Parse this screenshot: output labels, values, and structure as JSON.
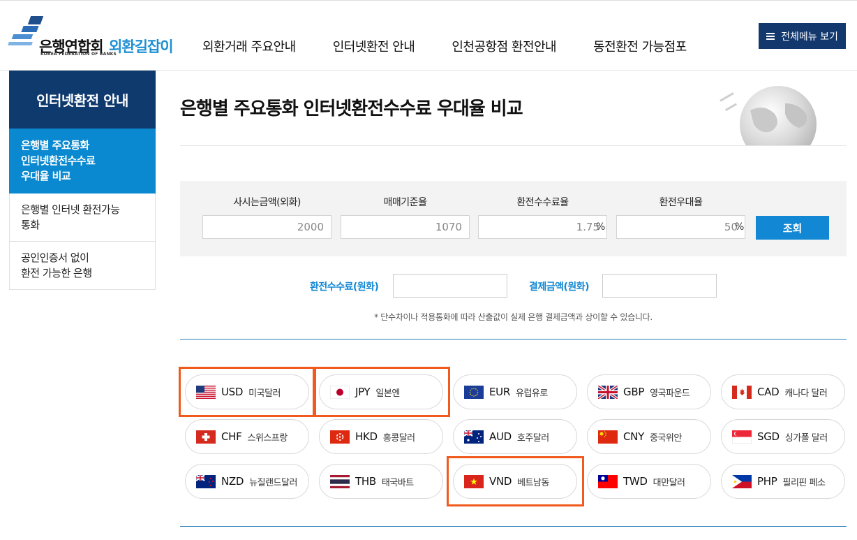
{
  "header": {
    "logo_kor": "은행연합회",
    "logo_sub": "KOREA FEDERATION OF BANKS",
    "logo_service": "외환길잡이",
    "nav": [
      "외환거래 주요안내",
      "인터넷환전 안내",
      "인천공항점 환전안내",
      "동전환전 가능점포"
    ],
    "all_menu": "전체메뉴 보기"
  },
  "side": {
    "title": "인터넷환전 안내",
    "items": [
      {
        "label": "은행별 주요통화\n인터넷환전수수료\n우대율 비교",
        "active": true
      },
      {
        "label": "은행별 인터넷 환전가능\n통화",
        "active": false
      },
      {
        "label": "공인인증서 없이\n환전 가능한 은행",
        "active": false
      }
    ]
  },
  "main": {
    "title": "은행별 주요통화 인터넷환전수수료 우대율 비교",
    "calc": {
      "labels": [
        "사시는금액(외화)",
        "매매기준율",
        "환전수수료율",
        "환전우대율"
      ],
      "values": [
        "2000",
        "1070",
        "1.75",
        "50"
      ],
      "pct": "%",
      "search": "조회"
    },
    "result": {
      "fee_label": "환전수수료(원화)",
      "pay_label": "결제금액(원화)"
    },
    "note": "* 단수차이나 적용통화에 따라 산출값이 실제 은행 결제금액과 상이할 수 있습니다.",
    "currencies": [
      {
        "code": "USD",
        "name": "미국달러",
        "flag": "us-flag-icon"
      },
      {
        "code": "JPY",
        "name": "일본엔",
        "flag": "jp-flag-icon"
      },
      {
        "code": "EUR",
        "name": "유럽유로",
        "flag": "eu-flag-icon"
      },
      {
        "code": "GBP",
        "name": "영국파운드",
        "flag": "gb-flag-icon"
      },
      {
        "code": "CAD",
        "name": "캐나다 달러",
        "flag": "ca-flag-icon"
      },
      {
        "code": "CHF",
        "name": "스위스프랑",
        "flag": "ch-flag-icon"
      },
      {
        "code": "HKD",
        "name": "홍콩달러",
        "flag": "hk-flag-icon"
      },
      {
        "code": "AUD",
        "name": "호주달러",
        "flag": "au-flag-icon"
      },
      {
        "code": "CNY",
        "name": "중국위안",
        "flag": "cn-flag-icon"
      },
      {
        "code": "SGD",
        "name": "싱가폴 달러",
        "flag": "sg-flag-icon"
      },
      {
        "code": "NZD",
        "name": "뉴질랜드달러",
        "flag": "nz-flag-icon"
      },
      {
        "code": "THB",
        "name": "태국바트",
        "flag": "th-flag-icon"
      },
      {
        "code": "VND",
        "name": "베트남동",
        "flag": "vn-flag-icon"
      },
      {
        "code": "TWD",
        "name": "대만달러",
        "flag": "tw-flag-icon"
      },
      {
        "code": "PHP",
        "name": "필리핀 페소",
        "flag": "ph-flag-icon"
      }
    ],
    "highlighted": [
      "USD",
      "JPY",
      "VND"
    ]
  },
  "colors": {
    "navy": "#0f3a6e",
    "accent_blue": "#1287d3",
    "highlight": "#f05a1c"
  }
}
